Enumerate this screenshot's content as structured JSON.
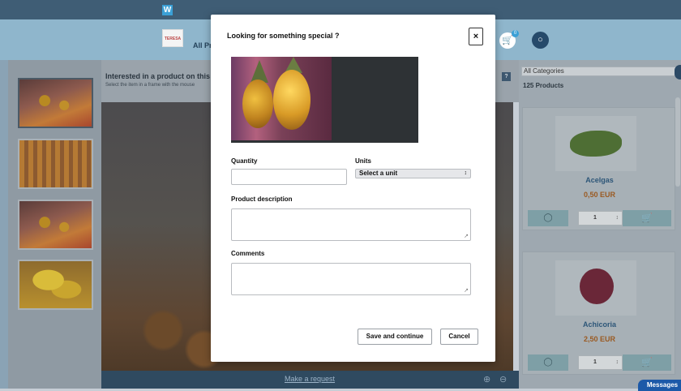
{
  "app": {
    "logo_letter": "W",
    "brand_logo_text": "TERESA"
  },
  "header": {
    "nav_all": "All Pr",
    "cart_icon": "🛒",
    "cart_count": "0",
    "user_icon": "○"
  },
  "viewer": {
    "title": "Interested in a product on this i",
    "subtitle": "Select the item in a frame with the mouse",
    "help_label": "?",
    "make_request": "Make a request",
    "zoom_in_icon": "⊕",
    "zoom_out_icon": "⊖"
  },
  "catalog": {
    "category": "All Categories",
    "count_label": "125 Products",
    "products": [
      {
        "name": "Acelgas",
        "price": "0,50 EUR",
        "qty": "1"
      },
      {
        "name": "Achicoria",
        "price": "2,50 EUR",
        "qty": "1"
      }
    ],
    "comment_icon": "◯",
    "cart_icon": "🛒",
    "spin_icon": "↕"
  },
  "messages_label": "Messages",
  "modal": {
    "title": "Looking for something special ?",
    "close_label": "×",
    "quantity_label": "Quantity",
    "units_label": "Units",
    "units_selected": "Select a unit",
    "units_arrow": "↕",
    "description_label": "Product description",
    "comments_label": "Comments",
    "resize_glyph": "↗",
    "save_label": "Save and continue",
    "cancel_label": "Cancel"
  }
}
